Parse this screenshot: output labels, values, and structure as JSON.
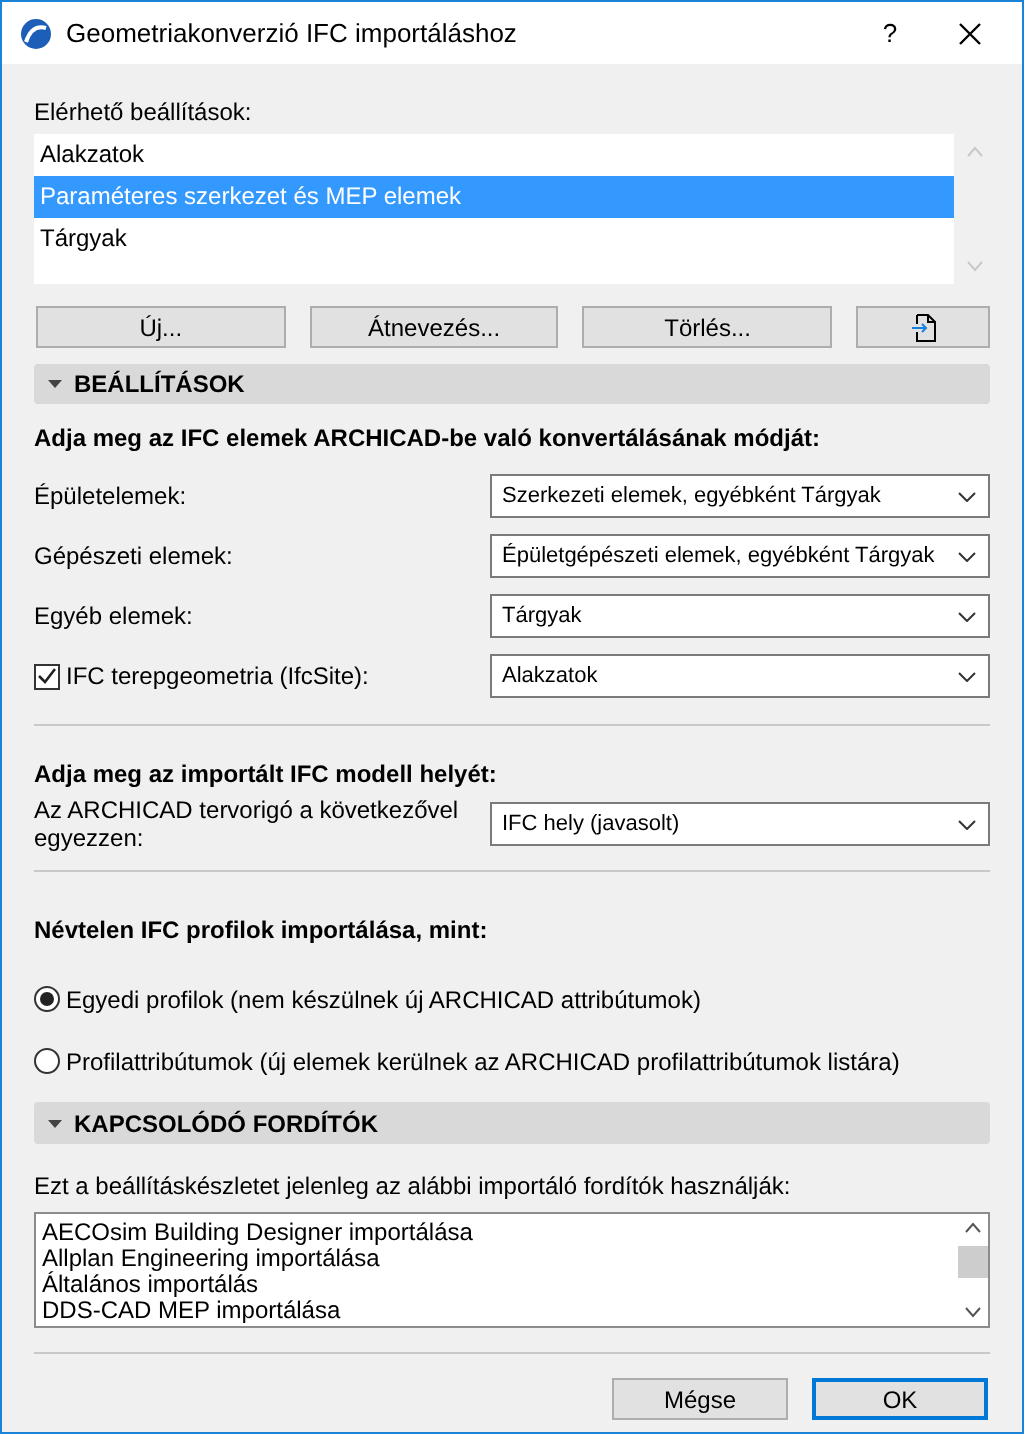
{
  "window": {
    "title": "Geometriakonverzió IFC importáláshoz",
    "help": "?"
  },
  "presets": {
    "label": "Elérhető beállítások:",
    "items": [
      {
        "label": "Alakzatok",
        "selected": false
      },
      {
        "label": "Paraméteres szerkezet és MEP elemek",
        "selected": true
      },
      {
        "label": "Tárgyak",
        "selected": false
      }
    ]
  },
  "preset_buttons": [
    "Új...",
    "Átnevezés...",
    "Törlés..."
  ],
  "settings": {
    "title": "BEÁLLÍTÁSOK",
    "expanded": true,
    "conversion": {
      "heading": "Adja meg az IFC elemek ARCHICAD-be való konvertálásának módját:",
      "rows": [
        {
          "kind": "label",
          "label": "Épületelemek:",
          "value": "Szerkezeti elemek, egyébként Tárgyak"
        },
        {
          "kind": "label",
          "label": "Gépészeti elemek:",
          "value": "Épületgépészeti elemek, egyébként Tárgyak"
        },
        {
          "kind": "label",
          "label": "Egyéb elemek:",
          "value": "Tárgyak"
        },
        {
          "kind": "checkbox",
          "label": "IFC terepgeometria (IfcSite):",
          "checked": true,
          "value": "Alakzatok"
        }
      ]
    },
    "location": {
      "heading": "Adja meg az importált IFC modell helyét:",
      "label": "Az ARCHICAD tervorigó a következővel egyezzen:",
      "value": "IFC hely (javasolt)"
    },
    "profiles": {
      "heading": "Névtelen IFC profilok importálása, mint:",
      "options": [
        {
          "label": "Egyedi profilok (nem készülnek új ARCHICAD attribútumok)",
          "selected": true
        },
        {
          "label": "Profilattribútumok (új elemek kerülnek az ARCHICAD profilattribútumok listára)",
          "selected": false
        }
      ]
    }
  },
  "translators": {
    "title": "KAPCSOLÓDÓ FORDÍTÓK",
    "expanded": true,
    "description": "Ezt a beállításkészletet jelenleg az alábbi importáló fordítók használják:",
    "items": [
      "AECOsim Building Designer importálása",
      "Allplan Engineering importálása",
      "Általános importálás",
      "DDS-CAD MEP importálása"
    ]
  },
  "buttons": [
    {
      "label": "Mégse",
      "default": false
    },
    {
      "label": "OK",
      "default": true
    }
  ]
}
